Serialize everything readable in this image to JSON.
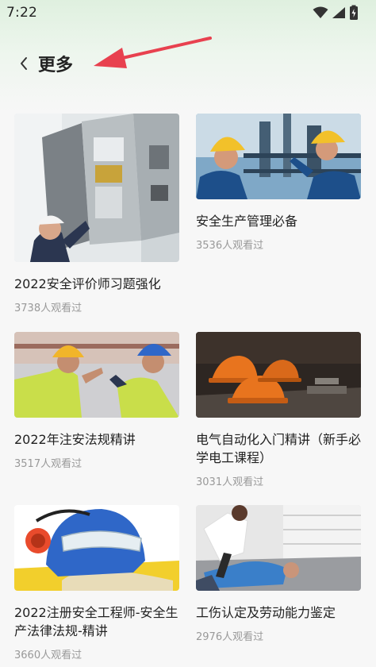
{
  "status_bar": {
    "time": "7:22",
    "icons": [
      "wifi-icon",
      "signal-icon",
      "battery-icon"
    ]
  },
  "header": {
    "back_icon": "chevron-left-icon",
    "title": "更多"
  },
  "colors": {
    "accent_arrow": "#e8414f",
    "header_gradient_top": "#dff0df",
    "background": "#f7f7f7",
    "title_text": "#222222",
    "meta_text": "#999999"
  },
  "courses": [
    {
      "title": "2022安全评价师习题强化",
      "views": "3738人观看过",
      "image": "worker-at-electrical-cabinet"
    },
    {
      "title": "安全生产管理必备",
      "views": "3536人观看过",
      "image": "engineers-in-hardhats-at-refinery"
    },
    {
      "title": "2022年注安法规精讲",
      "views": "3517人观看过",
      "image": "workers-in-safety-vests"
    },
    {
      "title": "电气自动化入门精讲（新手必学电工课程）",
      "views": "3031人观看过",
      "image": "orange-hardhats-on-table"
    },
    {
      "title": "2022注册安全工程师-安全生产法律法规-精讲",
      "views": "3660人观看过",
      "image": "blue-hardhat-goggles-earmuffs"
    },
    {
      "title": "工伤认定及劳动能力鉴定",
      "views": "2976人观看过",
      "image": "injured-worker-on-floor"
    }
  ]
}
